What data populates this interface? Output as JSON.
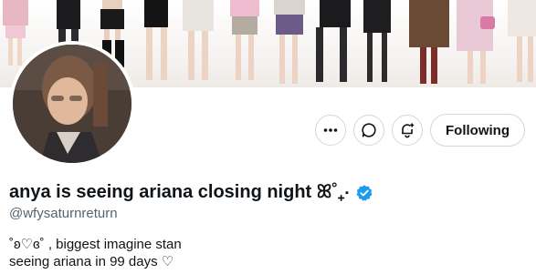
{
  "profile": {
    "display_name": "anya is seeing ariana closing night ꕤ˚₊‧",
    "verified_icon": "verified-badge-icon",
    "handle": "@wfysaturnreturn",
    "bio_lines": [
      "˚ʚ♡ɞ˚ , biggest imagine stan",
      "seeing ariana in 99 days ♡"
    ]
  },
  "actions": {
    "more_icon": "more-options-icon",
    "message_icon": "message-bubble-icon",
    "notify_icon": "notification-bell-icon",
    "follow_label": "Following"
  },
  "colors": {
    "verified": "#1d9bf0",
    "border": "#cfd9de",
    "secondary_text": "#536471",
    "primary_text": "#0f1419"
  }
}
